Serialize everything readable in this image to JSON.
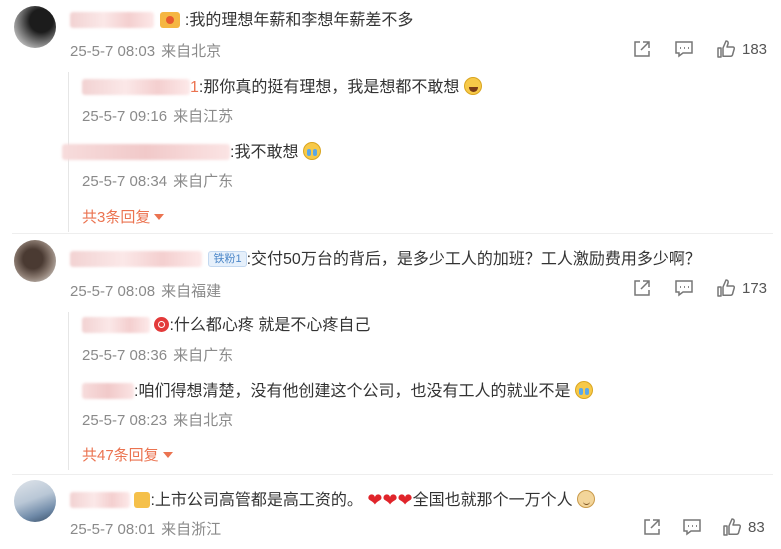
{
  "comments": [
    {
      "text": ":我的理想年薪和李想年薪差不多",
      "date": "25-5-7 08:03",
      "location": "来自北京",
      "likes": "183",
      "replies": [
        {
          "name_tail": "1",
          "text": ":那你真的挺有理想，我是想都不敢想",
          "emoji": "laughing-tears-emoji",
          "date": "25-5-7 09:16",
          "location": "来自江苏"
        },
        {
          "text": ":我不敢想",
          "emoji": "crying-emoji",
          "date": "25-5-7 08:34",
          "location": "来自广东"
        }
      ],
      "more_replies": "共3条回复"
    },
    {
      "fan_badge": "铁粉1",
      "text": ":交付50万台的背后，是多少工人的加班？工人激励费用多少啊？",
      "date": "25-5-7 08:08",
      "location": "来自福建",
      "likes": "173",
      "replies": [
        {
          "text": ":什么都心疼 就是不心疼自己",
          "date": "25-5-7 08:36",
          "location": "来自广东"
        },
        {
          "text": ":咱们得想清楚，没有他创建这个公司，也没有工人的就业不是",
          "emoji": "crying-emoji",
          "date": "25-5-7 08:23",
          "location": "来自北京"
        }
      ],
      "more_replies": "共47条回复"
    },
    {
      "text_before": ":上市公司高管都是高工资的。",
      "text_after": "全国也就那个一万个人",
      "emoji": "dog-emoji",
      "date": "25-5-7 08:01",
      "location": "来自浙江",
      "likes": "83"
    }
  ],
  "icons": {
    "share": "share-icon",
    "comment": "comment-icon",
    "like": "thumbs-up-icon"
  },
  "colors": {
    "accent": "#eb7350",
    "meta": "#8a8a8a",
    "heart": "#e0242a"
  }
}
